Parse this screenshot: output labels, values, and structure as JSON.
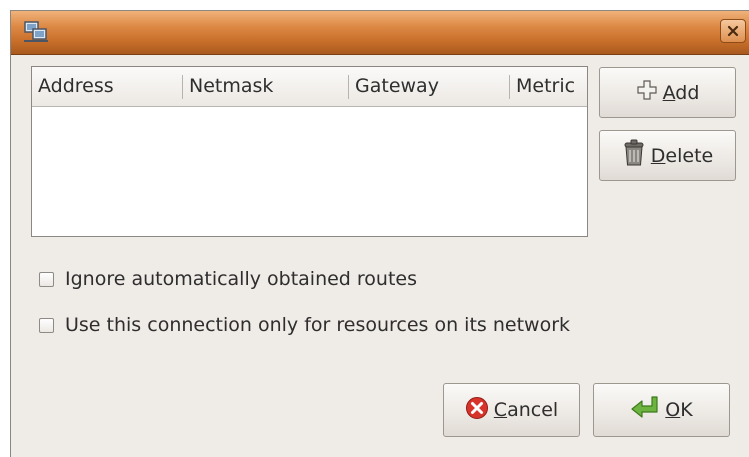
{
  "table": {
    "columns": [
      "Address",
      "Netmask",
      "Gateway",
      "Metric"
    ],
    "rows": []
  },
  "buttons": {
    "add": {
      "mnemonic": "A",
      "rest": "dd"
    },
    "delete": {
      "mnemonic": "D",
      "rest": "elete"
    },
    "cancel": {
      "mnemonic": "C",
      "rest": "ancel"
    },
    "ok": {
      "mnemonic": "O",
      "rest": "K"
    }
  },
  "options": {
    "ignore_routes": {
      "label": "Ignore automatically obtained routes",
      "checked": false
    },
    "local_only": {
      "label": "Use this connection only for resources on its network",
      "checked": false
    }
  },
  "icons": {
    "window": "network-connections-icon",
    "close": "close-icon",
    "add": "plus-icon",
    "delete": "trash-icon",
    "cancel": "cancel-icon",
    "ok": "ok-arrow-icon"
  },
  "colors": {
    "titlebar": "#d9823f",
    "dialog_bg": "#efebe7",
    "cancel_red": "#d7332b",
    "ok_green": "#6db33f"
  }
}
